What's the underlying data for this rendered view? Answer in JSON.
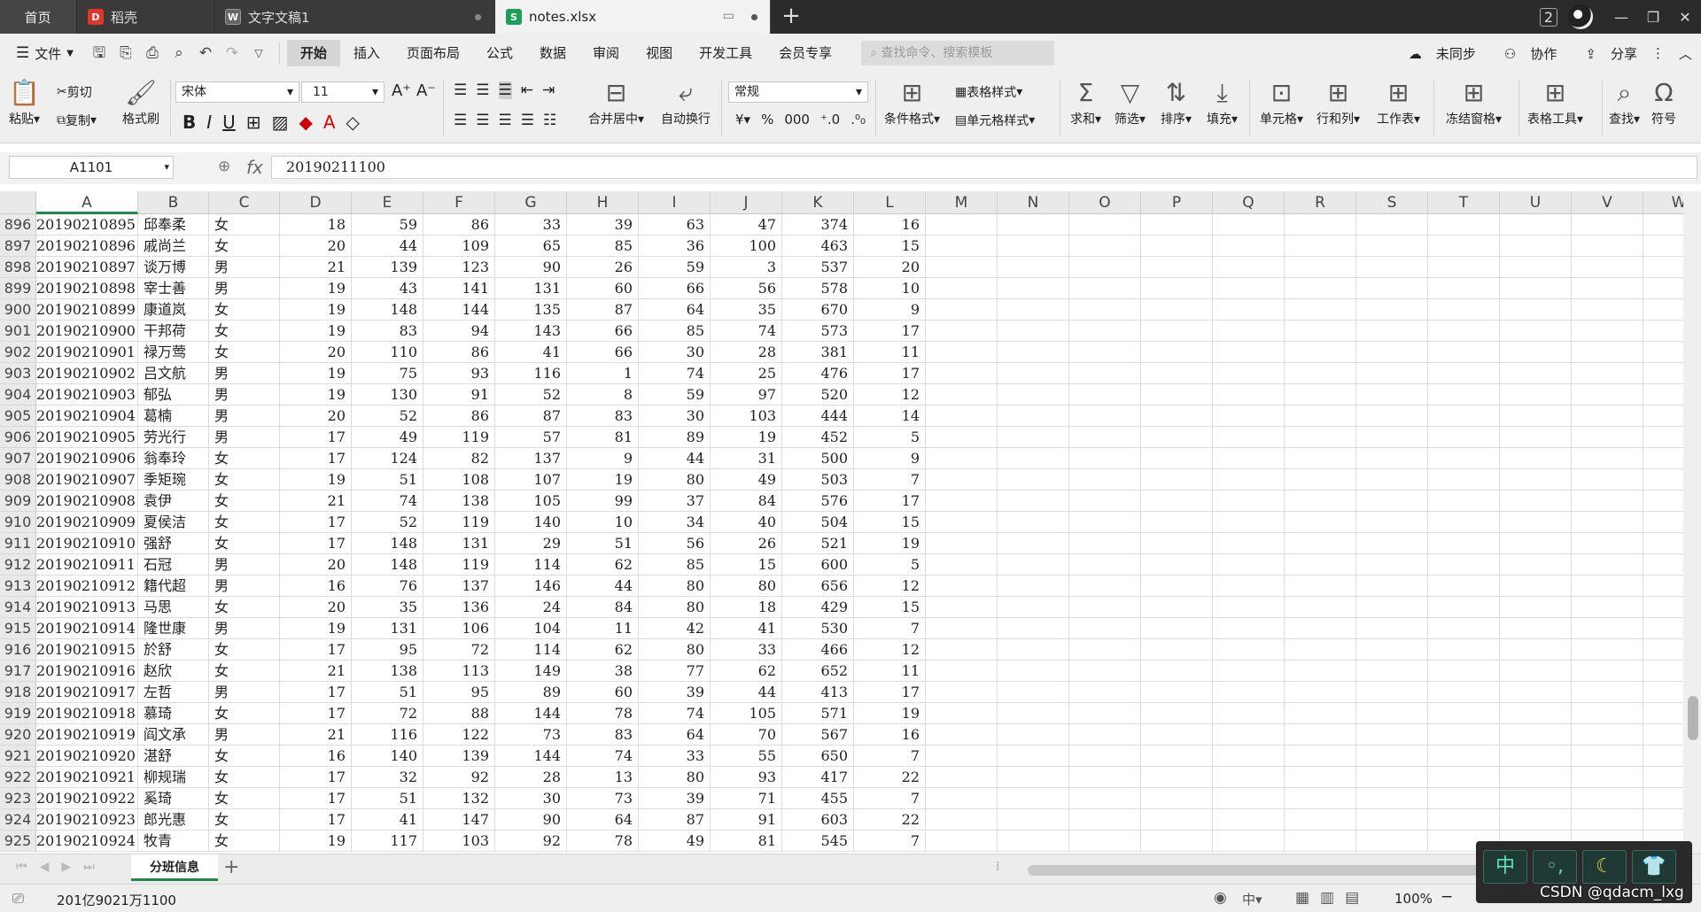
{
  "titlebar": {
    "home": "首页",
    "daoke": "稻壳",
    "doc": "文字文稿1",
    "notes": "notes.xlsx",
    "badge": "2"
  },
  "menu": {
    "file": "文件",
    "tabs": [
      "开始",
      "插入",
      "页面布局",
      "公式",
      "数据",
      "审阅",
      "视图",
      "开发工具",
      "会员专享"
    ],
    "search_placeholder": "查找命令、搜索模板",
    "unsync": "未同步",
    "collab": "协作",
    "share": "分享"
  },
  "ribbon": {
    "paste": "粘贴",
    "cut": "剪切",
    "copy": "复制",
    "format_painter": "格式刷",
    "font": "宋体",
    "size": "11",
    "merge": "合并居中",
    "wrap": "自动换行",
    "number_format": "常规",
    "cond_format": "条件格式",
    "table_style": "表格样式",
    "cell_style": "单元格样式",
    "sum": "求和",
    "filter": "筛选",
    "sort": "排序",
    "fill": "填充",
    "cell": "单元格",
    "rowcol": "行和列",
    "worksheet": "工作表",
    "freeze": "冻结窗格",
    "table_tools": "表格工具",
    "find": "查找",
    "symbol": "符号"
  },
  "formula_bar": {
    "name_box": "A1101",
    "fx": "fx",
    "value": "20190211100"
  },
  "columns": [
    "A",
    "B",
    "C",
    "D",
    "E",
    "F",
    "G",
    "H",
    "I",
    "J",
    "K",
    "L",
    "M",
    "N",
    "O",
    "P",
    "Q",
    "R",
    "S",
    "T",
    "U",
    "V",
    "W"
  ],
  "rows": [
    [
      "896",
      "20190210895",
      "邱奉柔",
      "女",
      "18",
      "59",
      "86",
      "33",
      "39",
      "63",
      "47",
      "374",
      "16"
    ],
    [
      "897",
      "20190210896",
      "戚尚兰",
      "女",
      "20",
      "44",
      "109",
      "65",
      "85",
      "36",
      "100",
      "463",
      "15"
    ],
    [
      "898",
      "20190210897",
      "谈万博",
      "男",
      "21",
      "139",
      "123",
      "90",
      "26",
      "59",
      "3",
      "537",
      "20"
    ],
    [
      "899",
      "20190210898",
      "宰士善",
      "男",
      "19",
      "43",
      "141",
      "131",
      "60",
      "66",
      "56",
      "578",
      "10"
    ],
    [
      "900",
      "20190210899",
      "康道岚",
      "女",
      "19",
      "148",
      "144",
      "135",
      "87",
      "64",
      "35",
      "670",
      "9"
    ],
    [
      "901",
      "20190210900",
      "干邦荷",
      "女",
      "19",
      "83",
      "94",
      "143",
      "66",
      "85",
      "74",
      "573",
      "17"
    ],
    [
      "902",
      "20190210901",
      "禄万莺",
      "女",
      "20",
      "110",
      "86",
      "41",
      "66",
      "30",
      "28",
      "381",
      "11"
    ],
    [
      "903",
      "20190210902",
      "吕文航",
      "男",
      "19",
      "75",
      "93",
      "116",
      "1",
      "74",
      "25",
      "476",
      "17"
    ],
    [
      "904",
      "20190210903",
      "郁弘",
      "男",
      "19",
      "130",
      "91",
      "52",
      "8",
      "59",
      "97",
      "520",
      "12"
    ],
    [
      "905",
      "20190210904",
      "葛楠",
      "男",
      "20",
      "52",
      "86",
      "87",
      "83",
      "30",
      "103",
      "444",
      "14"
    ],
    [
      "906",
      "20190210905",
      "劳光行",
      "男",
      "17",
      "49",
      "119",
      "57",
      "81",
      "89",
      "19",
      "452",
      "5"
    ],
    [
      "907",
      "20190210906",
      "翁奉玲",
      "女",
      "17",
      "124",
      "82",
      "137",
      "9",
      "44",
      "31",
      "500",
      "9"
    ],
    [
      "908",
      "20190210907",
      "季矩琬",
      "女",
      "19",
      "51",
      "108",
      "107",
      "19",
      "80",
      "49",
      "503",
      "7"
    ],
    [
      "909",
      "20190210908",
      "袁伊",
      "女",
      "21",
      "74",
      "138",
      "105",
      "99",
      "37",
      "84",
      "576",
      "17"
    ],
    [
      "910",
      "20190210909",
      "夏侯洁",
      "女",
      "17",
      "52",
      "119",
      "140",
      "10",
      "34",
      "40",
      "504",
      "15"
    ],
    [
      "911",
      "20190210910",
      "强舒",
      "女",
      "17",
      "148",
      "131",
      "29",
      "51",
      "56",
      "26",
      "521",
      "19"
    ],
    [
      "912",
      "20190210911",
      "石冠",
      "男",
      "20",
      "148",
      "119",
      "114",
      "62",
      "85",
      "15",
      "600",
      "5"
    ],
    [
      "913",
      "20190210912",
      "籍代超",
      "男",
      "16",
      "76",
      "137",
      "146",
      "44",
      "80",
      "80",
      "656",
      "12"
    ],
    [
      "914",
      "20190210913",
      "马思",
      "女",
      "20",
      "35",
      "136",
      "24",
      "84",
      "80",
      "18",
      "429",
      "15"
    ],
    [
      "915",
      "20190210914",
      "隆世康",
      "男",
      "19",
      "131",
      "106",
      "104",
      "11",
      "42",
      "41",
      "530",
      "7"
    ],
    [
      "916",
      "20190210915",
      "於舒",
      "女",
      "17",
      "95",
      "72",
      "114",
      "62",
      "80",
      "33",
      "466",
      "12"
    ],
    [
      "917",
      "20190210916",
      "赵欣",
      "女",
      "21",
      "138",
      "113",
      "149",
      "38",
      "77",
      "62",
      "652",
      "11"
    ],
    [
      "918",
      "20190210917",
      "左哲",
      "男",
      "17",
      "51",
      "95",
      "89",
      "60",
      "39",
      "44",
      "413",
      "17"
    ],
    [
      "919",
      "20190210918",
      "慕琦",
      "女",
      "17",
      "72",
      "88",
      "144",
      "78",
      "74",
      "105",
      "571",
      "19"
    ],
    [
      "920",
      "20190210919",
      "阎文承",
      "男",
      "21",
      "116",
      "122",
      "73",
      "83",
      "64",
      "70",
      "567",
      "16"
    ],
    [
      "921",
      "20190210920",
      "湛舒",
      "女",
      "16",
      "140",
      "139",
      "144",
      "74",
      "33",
      "55",
      "650",
      "7"
    ],
    [
      "922",
      "20190210921",
      "柳规瑞",
      "女",
      "17",
      "32",
      "92",
      "28",
      "13",
      "80",
      "93",
      "417",
      "22"
    ],
    [
      "923",
      "20190210922",
      "奚琦",
      "女",
      "17",
      "51",
      "132",
      "30",
      "73",
      "39",
      "71",
      "455",
      "7"
    ],
    [
      "924",
      "20190210923",
      "郎光惠",
      "女",
      "17",
      "41",
      "147",
      "90",
      "64",
      "87",
      "91",
      "603",
      "22"
    ],
    [
      "925",
      "20190210924",
      "牧青",
      "女",
      "19",
      "117",
      "103",
      "92",
      "78",
      "49",
      "81",
      "545",
      "7"
    ]
  ],
  "sheet": {
    "name": "分班信息"
  },
  "status": {
    "summary": "201亿9021万1100",
    "zoom": "100%"
  },
  "ime": {
    "lang": "中"
  },
  "watermark": "CSDN @qdacm_lxg",
  "colors": {
    "accent": "#1f8a4c",
    "titlebar": "#2b2b2b"
  }
}
